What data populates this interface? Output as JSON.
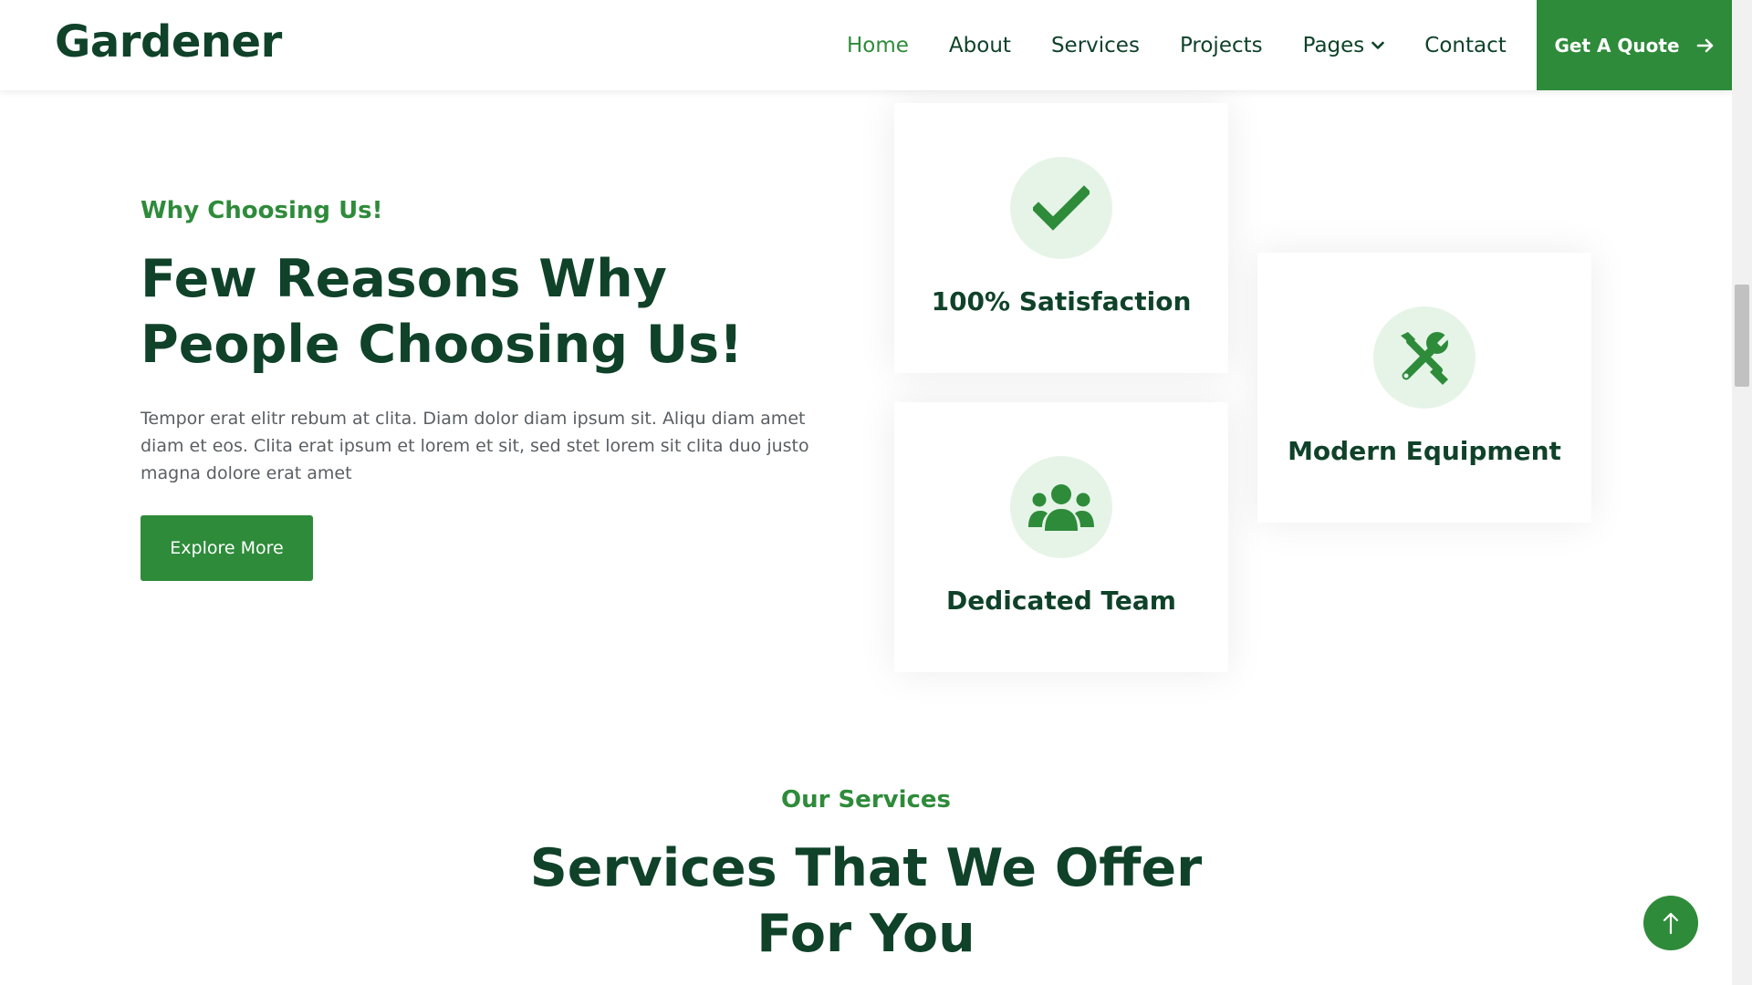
{
  "brand": "Gardener",
  "nav": {
    "items": [
      "Home",
      "About",
      "Services",
      "Projects",
      "Pages",
      "Contact"
    ],
    "active": "Home",
    "cta": "Get A Quote"
  },
  "intro": {
    "eyebrow": "Why Choosing Us!",
    "headline": "Few Reasons Why People Choosing Us!",
    "paragraph": "Tempor erat elitr rebum at clita. Diam dolor diam ipsum sit. Aliqu diam amet diam et eos. Clita erat ipsum et lorem et sit, sed stet lorem sit clita duo justo magna dolore erat amet",
    "button": "Explore More"
  },
  "features": [
    {
      "title": "100% Satisfaction",
      "icon": "check-icon"
    },
    {
      "title": "Dedicated Team",
      "icon": "users-icon"
    },
    {
      "title": "Modern Equipment",
      "icon": "tools-icon"
    }
  ],
  "services": {
    "eyebrow": "Our Services",
    "title": "Services That We Offer For You"
  },
  "colors": {
    "primary": "#2e8b3a",
    "dark": "#0f4229",
    "light_green": "#e6f4e8",
    "text": "#5a5f63"
  },
  "icons": {
    "dropdown": "chevron-down-icon",
    "cta_arrow": "arrow-right-icon",
    "back_to_top": "arrow-up-icon"
  }
}
